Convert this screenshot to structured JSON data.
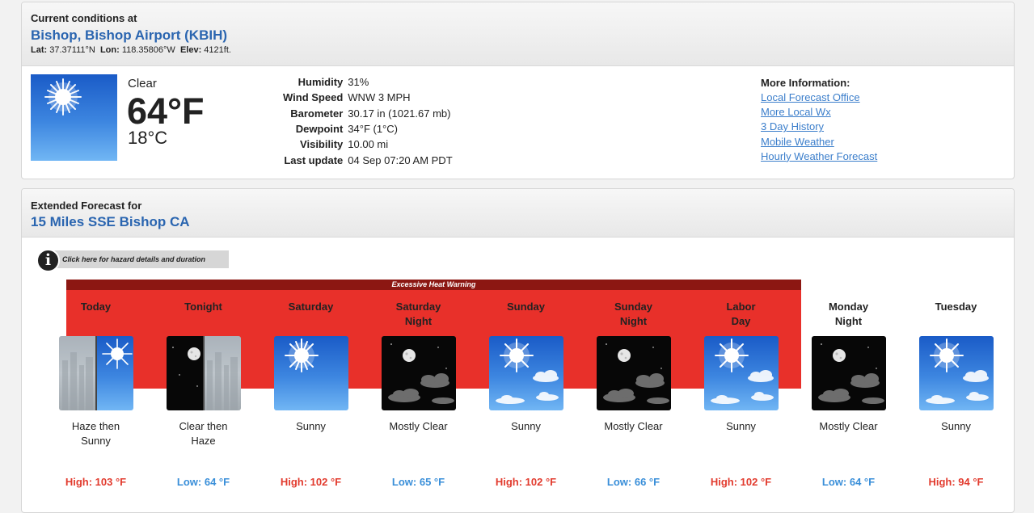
{
  "current": {
    "heading": "Current conditions at",
    "station": "Bishop, Bishop Airport (KBIH)",
    "lat_label": "Lat:",
    "lat": "37.37111°N",
    "lon_label": "Lon:",
    "lon": "118.35806°W",
    "elev_label": "Elev:",
    "elev": "4121ft.",
    "condition": "Clear",
    "temp_f": "64°F",
    "temp_c": "18°C",
    "icon": "sun-icon",
    "details": [
      {
        "label": "Humidity",
        "value": "31%"
      },
      {
        "label": "Wind Speed",
        "value": "WNW 3 MPH"
      },
      {
        "label": "Barometer",
        "value": "30.17 in (1021.67 mb)"
      },
      {
        "label": "Dewpoint",
        "value": "34°F (1°C)"
      },
      {
        "label": "Visibility",
        "value": "10.00 mi"
      },
      {
        "label": "Last update",
        "value": "04 Sep 07:20 AM PDT"
      }
    ],
    "more_title": "More Information:",
    "links": [
      "Local Forecast Office",
      "More Local Wx",
      "3 Day History",
      "Mobile Weather",
      "Hourly Weather Forecast"
    ]
  },
  "extended": {
    "heading": "Extended Forecast for",
    "location": "15 Miles SSE Bishop CA",
    "hazard_button": "Click here for hazard details and duration",
    "hazard_icon": "info-icon",
    "warning": "Excessive Heat Warning",
    "periods": [
      {
        "name": "Today",
        "name2": "",
        "icon": "haze-then-sun-icon",
        "desc": "Haze then",
        "desc2": "Sunny",
        "temp": "High: 103 °F"
      },
      {
        "name": "Tonight",
        "name2": "",
        "icon": "clear-then-haze-icon",
        "desc": "Clear then",
        "desc2": "Haze",
        "temp": "Low: 64 °F"
      },
      {
        "name": "Saturday",
        "name2": "",
        "icon": "sun-icon",
        "desc": "Sunny",
        "desc2": "",
        "temp": "High: 102 °F"
      },
      {
        "name": "Saturday",
        "name2": "Night",
        "icon": "moon-clouds-icon",
        "desc": "Mostly Clear",
        "desc2": "",
        "temp": "Low: 65 °F"
      },
      {
        "name": "Sunday",
        "name2": "",
        "icon": "sun-clouds-icon",
        "desc": "Sunny",
        "desc2": "",
        "temp": "High: 102 °F"
      },
      {
        "name": "Sunday",
        "name2": "Night",
        "icon": "moon-clouds-icon",
        "desc": "Mostly Clear",
        "desc2": "",
        "temp": "Low: 66 °F"
      },
      {
        "name": "Labor",
        "name2": "Day",
        "icon": "sun-clouds-icon",
        "desc": "Sunny",
        "desc2": "",
        "temp": "High: 102 °F"
      },
      {
        "name": "Monday",
        "name2": "Night",
        "icon": "moon-clouds-icon",
        "desc": "Mostly Clear",
        "desc2": "",
        "temp": "Low: 64 °F"
      },
      {
        "name": "Tuesday",
        "name2": "",
        "icon": "sun-clouds-icon",
        "desc": "Sunny",
        "desc2": "",
        "temp": "High: 94 °F"
      }
    ]
  },
  "colors": {
    "high_temp": "#e23b2e",
    "low_temp": "#3a8fd9",
    "warning_bg": "#e8302a",
    "warning_label_bg": "#8c1712",
    "heading_blue": "#2a65b0",
    "link_blue": "#3b7ecb"
  }
}
